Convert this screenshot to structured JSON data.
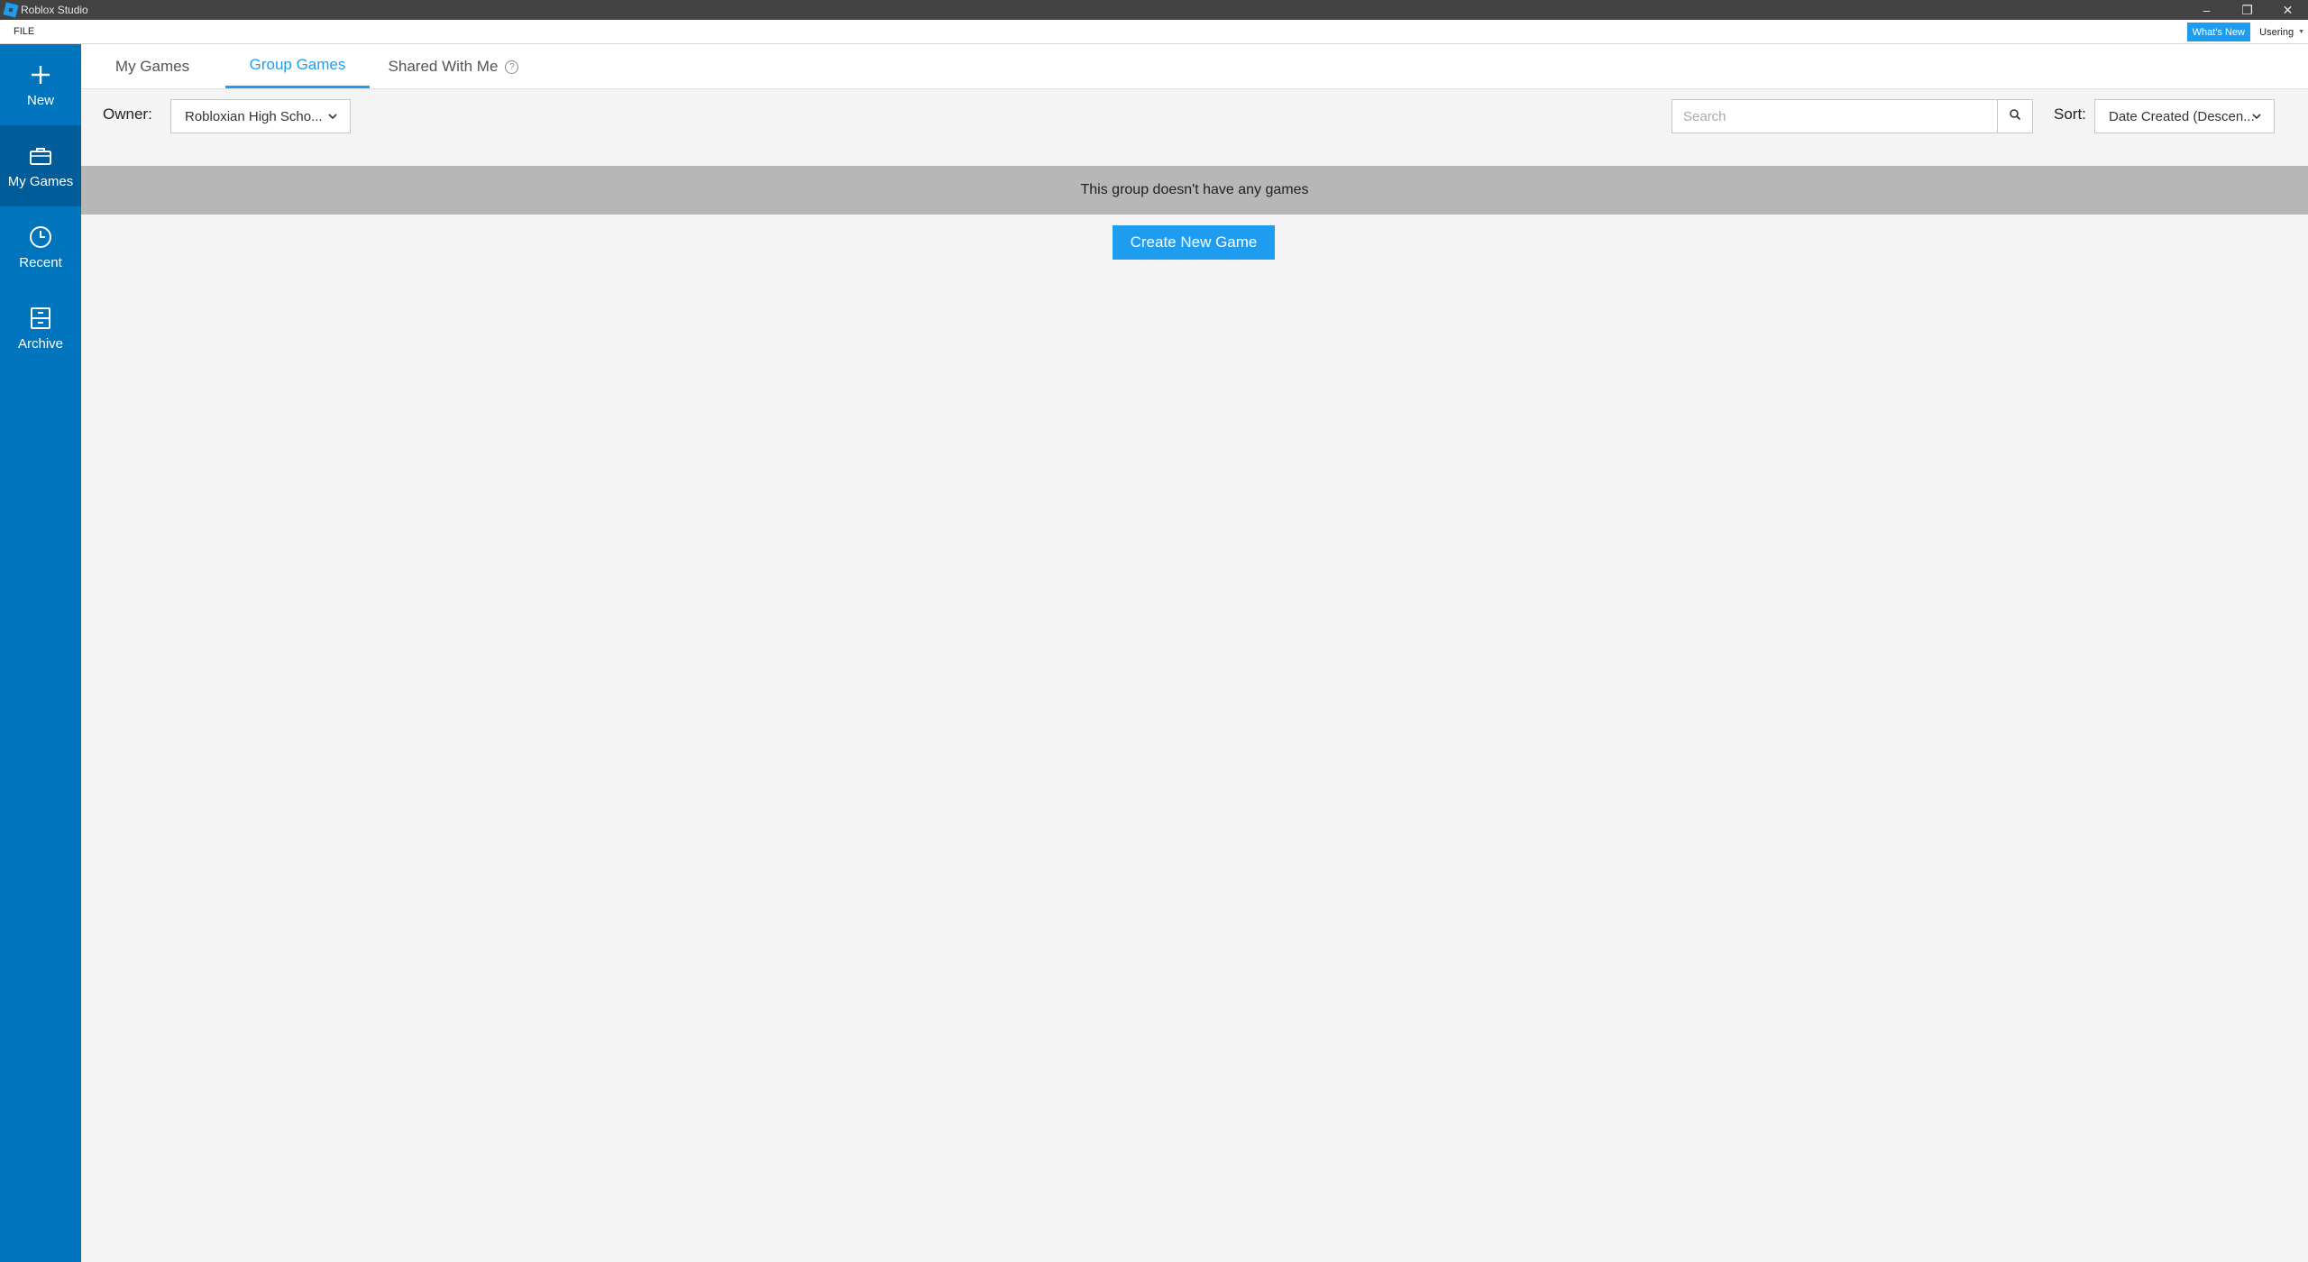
{
  "window": {
    "title": "Roblox Studio",
    "controls": {
      "minimize": "–",
      "restore": "❐",
      "close": "✕"
    }
  },
  "menubar": {
    "file": "FILE",
    "whats_new": "What's New",
    "user": "Usering"
  },
  "sidebar": {
    "items": [
      {
        "label": "New",
        "icon": "plus-icon"
      },
      {
        "label": "My Games",
        "icon": "briefcase-icon",
        "active": true
      },
      {
        "label": "Recent",
        "icon": "clock-icon"
      },
      {
        "label": "Archive",
        "icon": "archive-icon"
      }
    ]
  },
  "tabs": [
    {
      "label": "My Games"
    },
    {
      "label": "Group Games",
      "active": true
    },
    {
      "label": "Shared With Me",
      "help": "?"
    }
  ],
  "filters": {
    "owner_label": "Owner:",
    "owner_value": "Robloxian High Scho...",
    "search_placeholder": "Search",
    "search_value": "",
    "sort_label": "Sort:",
    "sort_value": "Date Created (Descen..."
  },
  "content": {
    "empty_message": "This group doesn't have any games",
    "create_button": "Create New Game"
  },
  "colors": {
    "accent": "#1e9cf0",
    "sidebar": "#0074bd",
    "sidebar_active": "#005d99",
    "banner": "#b7b7b7",
    "titlebar": "#424242"
  }
}
